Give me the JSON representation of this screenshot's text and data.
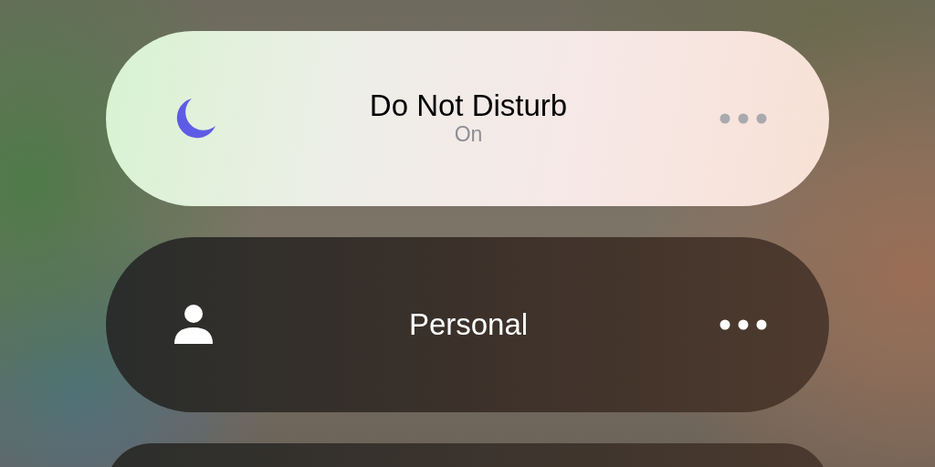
{
  "focus_modes": [
    {
      "kind": "moon",
      "title": "Do Not Disturb",
      "status": "On",
      "selected": true
    },
    {
      "kind": "person",
      "title": "Personal",
      "selected": false
    }
  ]
}
